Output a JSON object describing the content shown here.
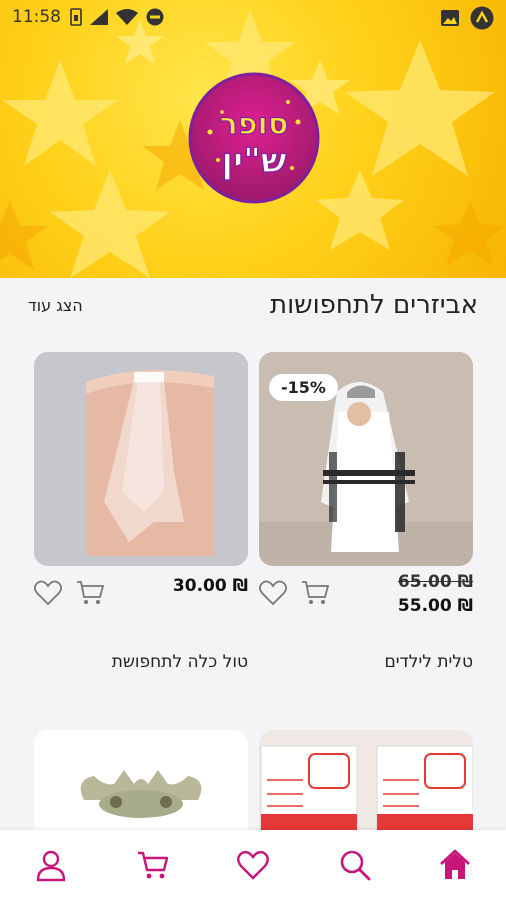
{
  "status_bar": {
    "time": "11:58"
  },
  "brand": {
    "logo_text_top": "סופר",
    "logo_text_bottom": "ש\"ין",
    "accent_color": "#c8157a",
    "background_color": "#ffd21c"
  },
  "section": {
    "title": "אביזרים לתחפושות",
    "show_more_label": "הצג עוד"
  },
  "products": [
    {
      "name": "טלית לילדים",
      "discount_badge": "-15%",
      "old_price": "₪ 65.00",
      "price": "₪ 55.00",
      "image_icon": "child-tallit-photo"
    },
    {
      "name": "טול כלה לתחפושת",
      "price": "₪ 30.00",
      "image_icon": "bridal-veil-photo"
    }
  ],
  "bottom_nav": {
    "items": [
      "home-icon",
      "search-icon",
      "heart-icon",
      "cart-icon",
      "user-icon"
    ]
  }
}
